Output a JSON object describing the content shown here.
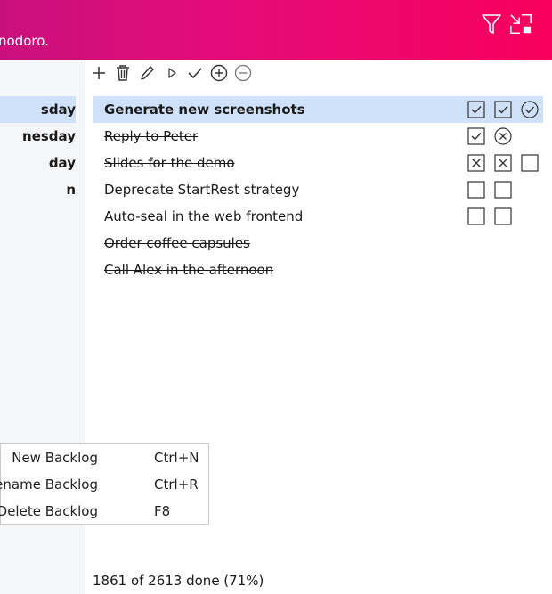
{
  "header": {
    "title_fragment": "nodoro.",
    "filter_icon": "filter-icon",
    "compact_icon": "compact-mode-icon"
  },
  "sidebar": {
    "items": [
      {
        "label": "sday",
        "selected": true
      },
      {
        "label": "nesday",
        "selected": false
      },
      {
        "label": "day",
        "selected": false
      },
      {
        "label": "n",
        "selected": false
      }
    ]
  },
  "toolbar": {
    "buttons": [
      "add-icon",
      "delete-icon",
      "edit-icon",
      "start-icon",
      "complete-icon",
      "add-pomodoro-icon",
      "remove-pomodoro-icon"
    ]
  },
  "tasks": [
    {
      "name": "Generate new screenshots",
      "done": false,
      "selected": true,
      "pomodoros": [
        "checked",
        "checked",
        "circle-check"
      ]
    },
    {
      "name": "Reply to Peter",
      "done": true,
      "selected": false,
      "pomodoros": [
        "checked",
        "circle-x"
      ]
    },
    {
      "name": "Slides for the demo",
      "done": true,
      "selected": false,
      "pomodoros": [
        "crossed",
        "crossed",
        "empty"
      ]
    },
    {
      "name": "Deprecate StartRest strategy",
      "done": false,
      "selected": false,
      "pomodoros": [
        "empty",
        "empty"
      ]
    },
    {
      "name": "Auto-seal in the web frontend",
      "done": false,
      "selected": false,
      "pomodoros": [
        "empty",
        "empty"
      ]
    },
    {
      "name": "Order coffee capsules",
      "done": true,
      "selected": false,
      "pomodoros": []
    },
    {
      "name": "Call Alex in the afternoon",
      "done": true,
      "selected": false,
      "pomodoros": []
    }
  ],
  "context_menu": {
    "items": [
      {
        "label": "New Backlog",
        "shortcut": "Ctrl+N"
      },
      {
        "label": "Rename Backlog",
        "shortcut": "Ctrl+R"
      },
      {
        "label": "Delete Backlog",
        "shortcut": "F8"
      }
    ]
  },
  "status": {
    "text": "1861 of 2613 done (71%)"
  },
  "colors": {
    "accent_start": "#c8107c",
    "accent_end": "#f8005c",
    "selection": "#cfe0f9"
  }
}
